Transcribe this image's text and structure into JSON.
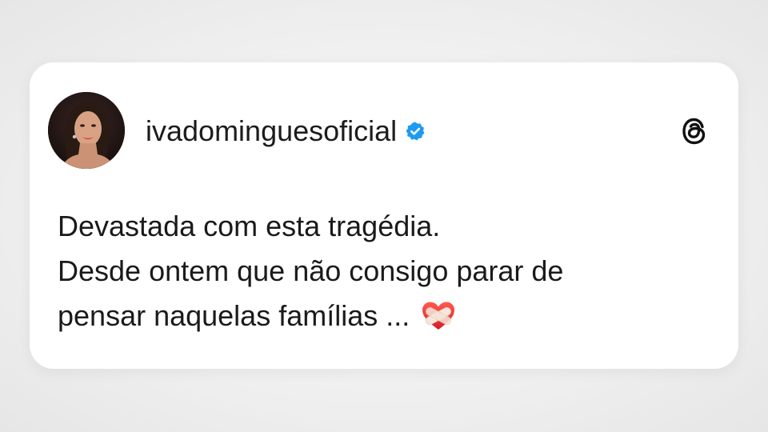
{
  "post": {
    "username": "ivadominguesoficial",
    "verified": true,
    "lines": [
      "Devastada com esta tragédia.",
      "Desde ontem que não consigo parar de",
      "pensar naquelas famílias ..."
    ],
    "emoji": "mending-heart-icon",
    "app_icon": "threads-icon"
  },
  "colors": {
    "background": "#efefef",
    "card": "#ffffff",
    "text": "#1a1a1a",
    "verified": "#1d9bf0",
    "heart": "#e53935"
  }
}
